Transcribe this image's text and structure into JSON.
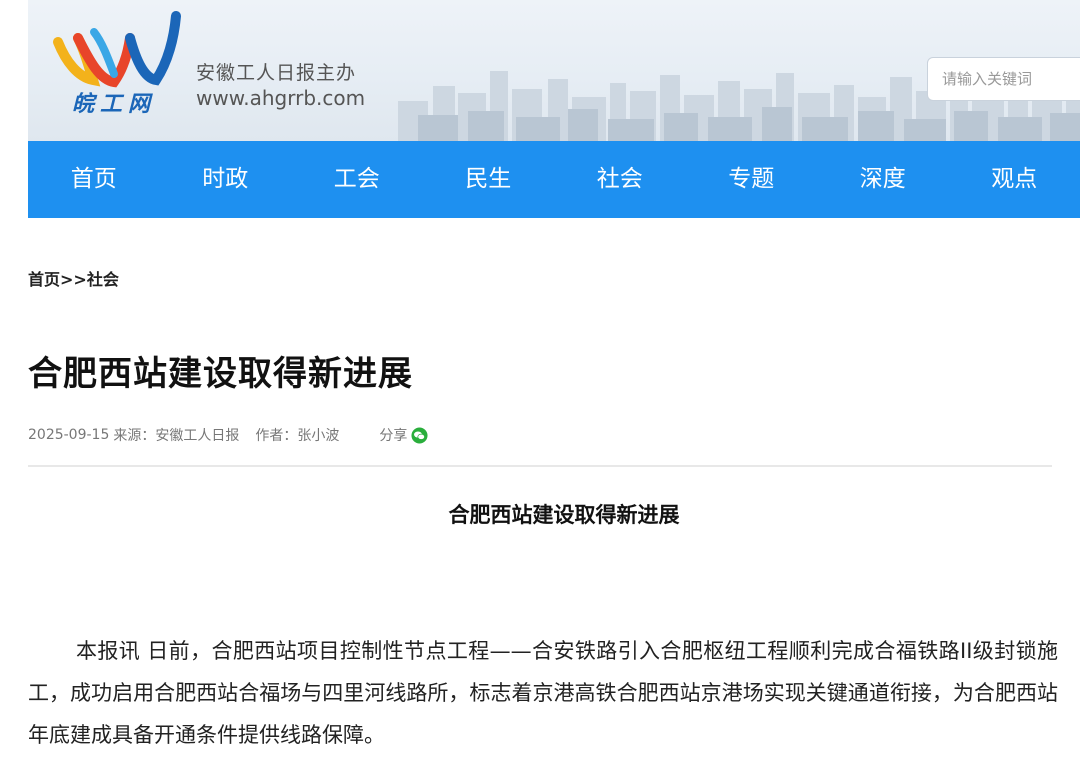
{
  "header": {
    "sponsor": "安徽工人日报主办",
    "domain": "www.ahgrrb.com",
    "logo_text": "皖工网",
    "search_placeholder": "请输入关键词"
  },
  "nav": {
    "items": [
      "首页",
      "时政",
      "工会",
      "民生",
      "社会",
      "专题",
      "深度",
      "观点"
    ]
  },
  "breadcrumb": {
    "home": "首页",
    "separator": ">>",
    "current": "社会"
  },
  "article": {
    "title": "合肥西站建设取得新进展",
    "date": "2025-09-15",
    "source": "来源：安徽工人日报",
    "author": "作者：张小波",
    "share_label": "分享",
    "subtitle": "合肥西站建设取得新进展",
    "paragraph": "本报讯  日前，合肥西站项目控制性节点工程——合安铁路引入合肥枢纽工程顺利完成合福铁路II级封锁施工，成功启用合肥西站合福场与四里河线路所，标志着京港高铁合肥西站京港场实现关键通道衔接，为合肥西站年底建成具备开通条件提供线路保障。"
  },
  "colors": {
    "nav_bg": "#1e90f0",
    "logo_blue": "#1b66b8",
    "wechat_green": "#2aae3c"
  }
}
